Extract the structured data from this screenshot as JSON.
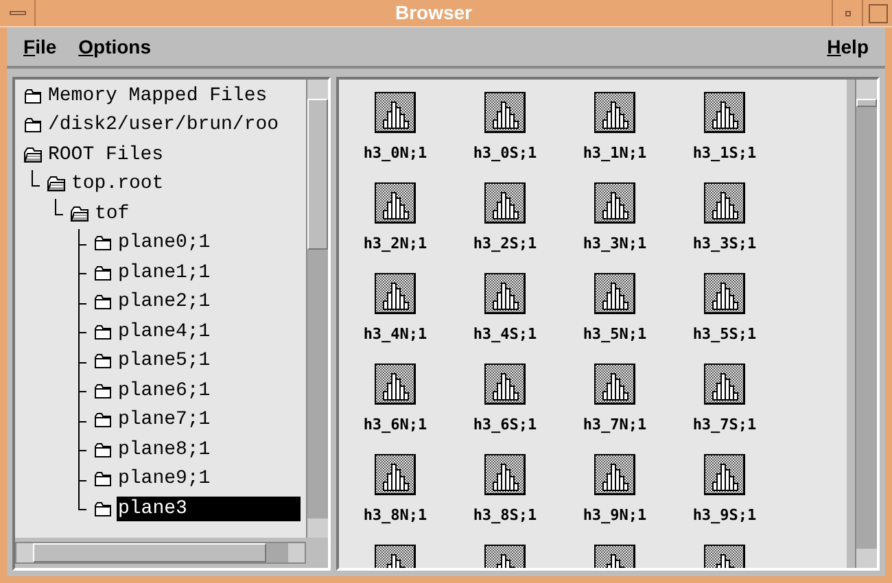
{
  "window": {
    "title": "Browser"
  },
  "menu": {
    "left": [
      "File",
      "Options"
    ],
    "right": [
      "Help"
    ]
  },
  "tree": [
    {
      "label": "Memory Mapped Files",
      "expanded": false,
      "selected": false
    },
    {
      "label": "/disk2/user/brun/roo",
      "expanded": false,
      "selected": false
    },
    {
      "label": "ROOT Files",
      "expanded": true,
      "selected": false,
      "children": [
        {
          "label": "top.root",
          "expanded": true,
          "selected": false,
          "children": [
            {
              "label": "tof",
              "expanded": true,
              "selected": false,
              "children": [
                {
                  "label": "plane0;1",
                  "expanded": false,
                  "selected": false
                },
                {
                  "label": "plane1;1",
                  "expanded": false,
                  "selected": false
                },
                {
                  "label": "plane2;1",
                  "expanded": false,
                  "selected": false
                },
                {
                  "label": "plane4;1",
                  "expanded": false,
                  "selected": false
                },
                {
                  "label": "plane5;1",
                  "expanded": false,
                  "selected": false
                },
                {
                  "label": "plane6;1",
                  "expanded": false,
                  "selected": false
                },
                {
                  "label": "plane7;1",
                  "expanded": false,
                  "selected": false
                },
                {
                  "label": "plane8;1",
                  "expanded": false,
                  "selected": false
                },
                {
                  "label": "plane9;1",
                  "expanded": false,
                  "selected": false
                },
                {
                  "label": "plane3",
                  "expanded": false,
                  "selected": true
                }
              ]
            }
          ]
        }
      ]
    }
  ],
  "contents": [
    {
      "kind": "histogram",
      "label": "h3_0N;1"
    },
    {
      "kind": "histogram",
      "label": "h3_0S;1"
    },
    {
      "kind": "histogram",
      "label": "h3_1N;1"
    },
    {
      "kind": "histogram",
      "label": "h3_1S;1"
    },
    {
      "kind": "histogram",
      "label": "h3_2N;1"
    },
    {
      "kind": "histogram",
      "label": "h3_2S;1"
    },
    {
      "kind": "histogram",
      "label": "h3_3N;1"
    },
    {
      "kind": "histogram",
      "label": "h3_3S;1"
    },
    {
      "kind": "histogram",
      "label": "h3_4N;1"
    },
    {
      "kind": "histogram",
      "label": "h3_4S;1"
    },
    {
      "kind": "histogram",
      "label": "h3_5N;1"
    },
    {
      "kind": "histogram",
      "label": "h3_5S;1"
    },
    {
      "kind": "histogram",
      "label": "h3_6N;1"
    },
    {
      "kind": "histogram",
      "label": "h3_6S;1"
    },
    {
      "kind": "histogram",
      "label": "h3_7N;1"
    },
    {
      "kind": "histogram",
      "label": "h3_7S;1"
    },
    {
      "kind": "histogram",
      "label": "h3_8N;1"
    },
    {
      "kind": "histogram",
      "label": "h3_8S;1"
    },
    {
      "kind": "histogram",
      "label": "h3_9N;1"
    },
    {
      "kind": "histogram",
      "label": "h3_9S;1"
    },
    {
      "kind": "histogram"
    },
    {
      "kind": "histogram"
    },
    {
      "kind": "histogram"
    },
    {
      "kind": "histogram"
    }
  ]
}
